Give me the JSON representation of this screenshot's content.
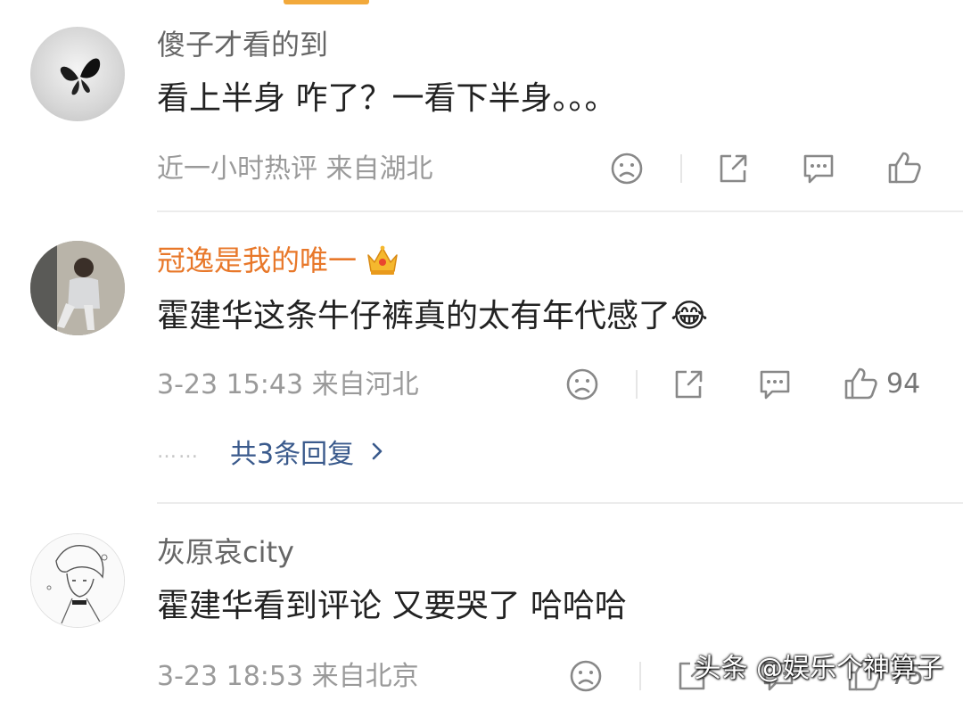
{
  "comments": [
    {
      "username": "傻子才看的到",
      "text": "看上半身 咋了？一看下半身。。。",
      "meta": "近一小时热评  来自湖北",
      "likes": ""
    },
    {
      "username": "冠逸是我的唯一",
      "badge_icon": "crown-icon",
      "text": "霍建华这条牛仔裤真的太有年代感了😂",
      "meta": "3-23 15:43  来自河北",
      "likes": "94",
      "replies_label": "共3条回复",
      "replies_dots": "……"
    },
    {
      "username": "灰原哀city",
      "text": "霍建华看到评论 又要哭了 哈哈哈",
      "meta": "3-23 18:53  来自北京",
      "likes": "75"
    }
  ],
  "watermark": "头条 @娱乐个神算子",
  "colors": {
    "vip_name": "#e8782a",
    "reply_link": "#3a5a8c",
    "meta_gray": "#9a9a9a",
    "accent_tab": "#f2a93b"
  }
}
